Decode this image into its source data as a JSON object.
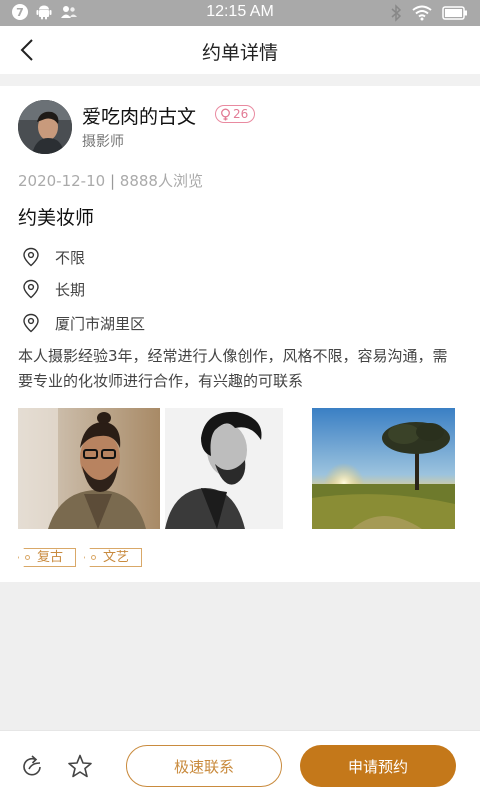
{
  "status_bar": {
    "time": "12:15 AM",
    "notification_count": "7"
  },
  "nav": {
    "title": "约单详情"
  },
  "author": {
    "name": "爱吃肉的古文",
    "likes": "26",
    "role": "摄影师"
  },
  "post": {
    "date": "2020-12-10",
    "views": "8888人浏览",
    "title": "约美妆师",
    "details": [
      {
        "icon": "location-pin-icon",
        "text": "不限"
      },
      {
        "icon": "location-pin-icon",
        "text": "长期"
      },
      {
        "icon": "location-pin-icon",
        "text": "厦门市湖里区"
      }
    ],
    "description": "本人摄影经验3年，经常进行人像创作，风格不限，容易沟通，需要专业的化妆师进行合作，有兴趣的可联系",
    "tags": [
      "复古",
      "文艺"
    ]
  },
  "actions": {
    "contact_label": "极速联系",
    "apply_label": "申请预约"
  },
  "colors": {
    "accent": "#c4781a",
    "accent_border": "#c98b3e",
    "like_badge": "#e27b95",
    "tag": "#c88a3e"
  }
}
